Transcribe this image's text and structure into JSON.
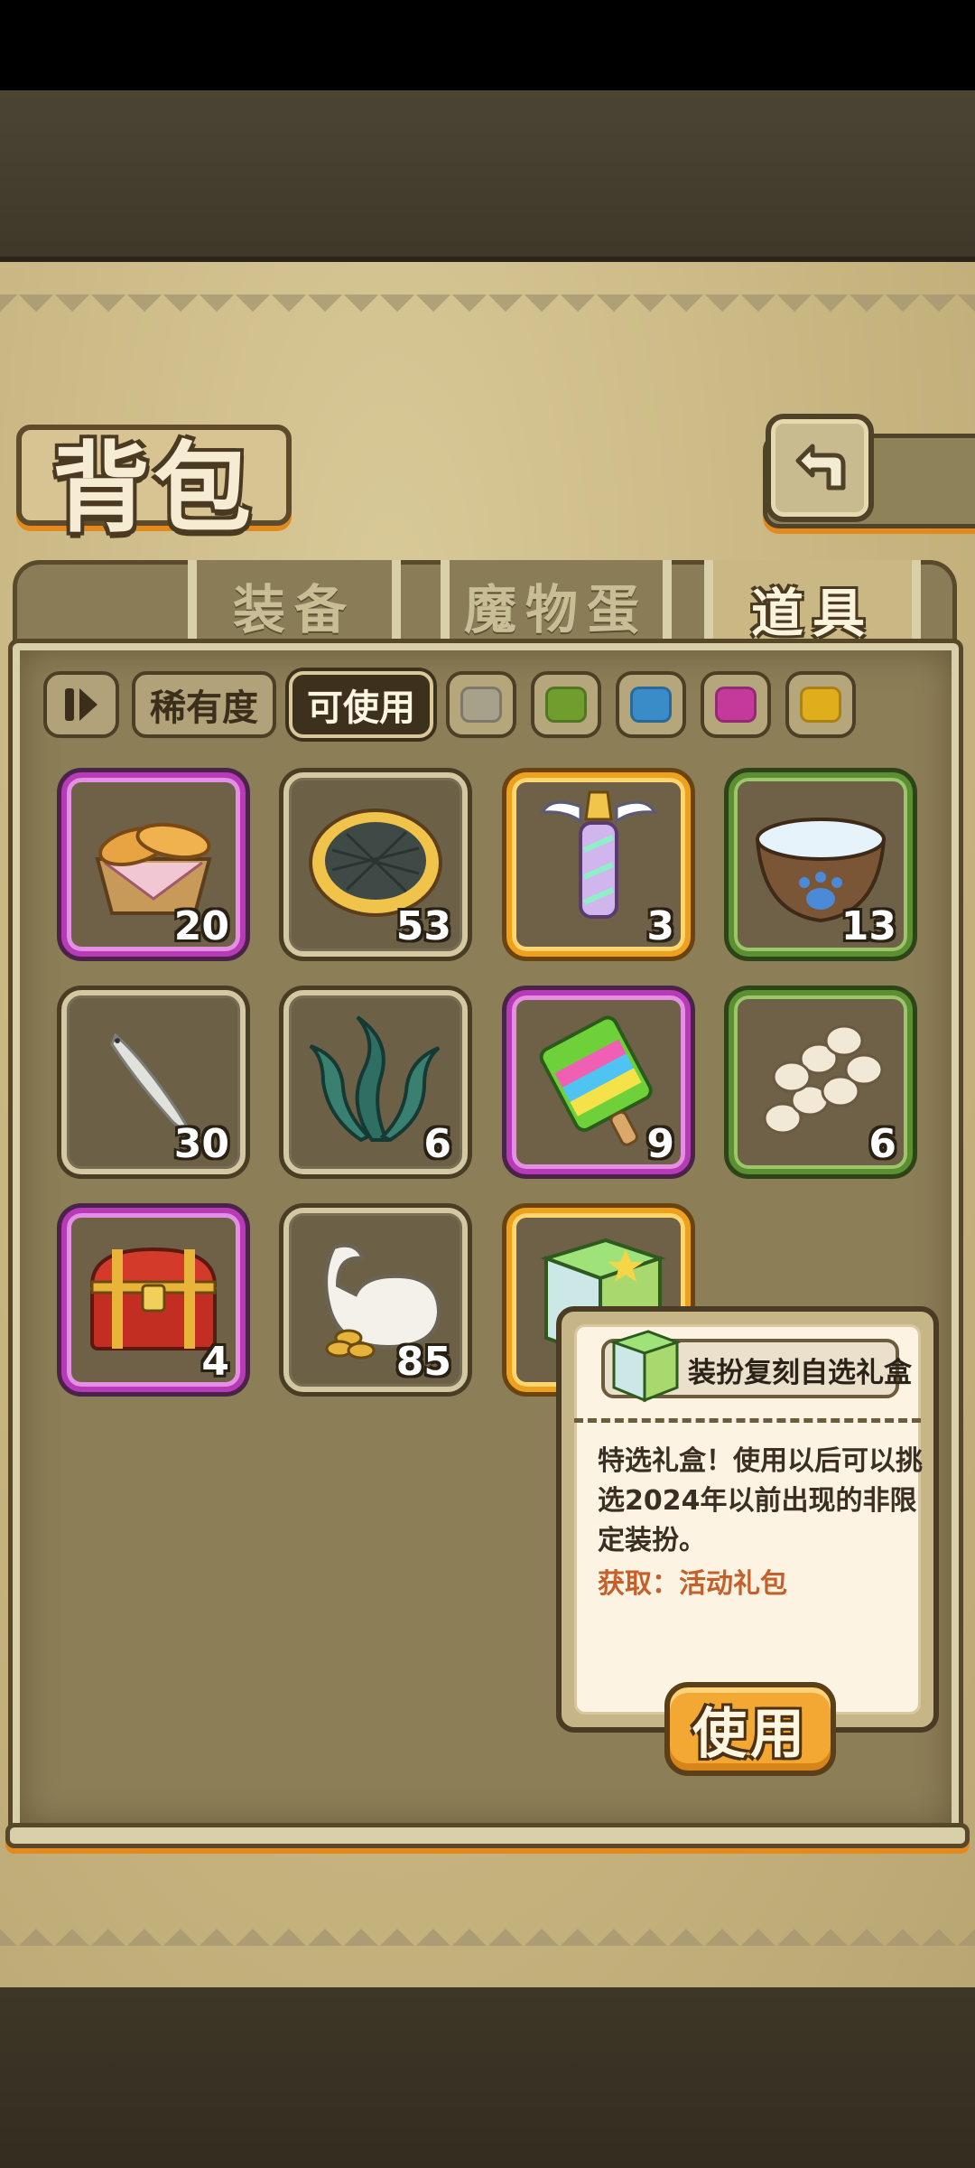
{
  "header": {
    "title": "背包"
  },
  "tabs": [
    {
      "label": "装备",
      "active": false
    },
    {
      "label": "魔物蛋",
      "active": false
    },
    {
      "label": "道具",
      "active": true
    }
  ],
  "filters": {
    "rarity_label": "稀有度",
    "usable_label": "可使用",
    "usable_active": true,
    "color_chips": [
      "#a7a08a",
      "#6f9e2e",
      "#3a8cc8",
      "#c43a9a",
      "#e0ae1c"
    ]
  },
  "items": [
    {
      "name": "bread-basket",
      "qty": "20",
      "rarity": "purple"
    },
    {
      "name": "seaweed-cookie",
      "qty": "53",
      "rarity": "normal"
    },
    {
      "name": "winged-lantern",
      "qty": "3",
      "rarity": "gold"
    },
    {
      "name": "water-bowl",
      "qty": "13",
      "rarity": "green"
    },
    {
      "name": "dried-fish",
      "qty": "30",
      "rarity": "normal"
    },
    {
      "name": "seaweed",
      "qty": "6",
      "rarity": "normal"
    },
    {
      "name": "rainbow-popsicle",
      "qty": "9",
      "rarity": "purple"
    },
    {
      "name": "eggs-pile",
      "qty": "6",
      "rarity": "green"
    },
    {
      "name": "treasure-chest",
      "qty": "4",
      "rarity": "purple"
    },
    {
      "name": "coin-sack",
      "qty": "85",
      "rarity": "normal"
    },
    {
      "name": "gift-box",
      "qty": "",
      "rarity": "gold"
    }
  ],
  "tooltip": {
    "title": "装扮复刻自选礼盒",
    "description": "特选礼盒！使用以后可以挑选2024年以前出现的非限定装扮。",
    "source": "获取：活动礼包",
    "use_label": "使用"
  }
}
